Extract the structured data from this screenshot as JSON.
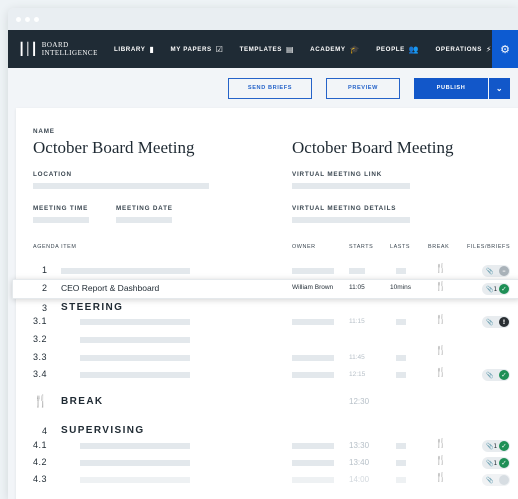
{
  "nav": {
    "logo_line1": "BOARD",
    "logo_line2": "INTELLIGENCE",
    "items": [
      {
        "label": "LIBRARY",
        "icon": "book-icon",
        "glyph": "▮"
      },
      {
        "label": "MY PAPERS",
        "icon": "checkbox-icon",
        "glyph": "☑"
      },
      {
        "label": "TEMPLATES",
        "icon": "template-icon",
        "glyph": "▤"
      },
      {
        "label": "ACADEMY",
        "icon": "graduation-cap-icon",
        "glyph": "🎓"
      },
      {
        "label": "PEOPLE",
        "icon": "people-icon",
        "glyph": "👥"
      },
      {
        "label": "OPERATIONS",
        "icon": "pulse-icon",
        "glyph": "⚡"
      }
    ],
    "gear_glyph": "⚙"
  },
  "toolbar": {
    "send_label": "SEND BRIEFS",
    "preview_label": "PREVIEW",
    "publish_label": "PUBLISH",
    "caret_glyph": "⌄"
  },
  "meeting": {
    "name_label": "NAME",
    "title": "October Board Meeting",
    "title_right": "October Board Meeting",
    "location_label": "LOCATION",
    "virtual_link_label": "VIRTUAL MEETING LINK",
    "time_label": "MEETING TIME",
    "date_label": "MEETING DATE",
    "virtual_details_label": "VIRTUAL MEETING DETAILS"
  },
  "agenda": {
    "headers": {
      "item": "AGENDA ITEM",
      "owner": "OWNER",
      "starts": "STARTS",
      "lasts": "LASTS",
      "break": "BREAK",
      "files": "FILES/BRIEFS"
    },
    "rows": {
      "r1": {
        "num": "1"
      },
      "r2": {
        "num": "2",
        "title": "CEO Report & Dashboard",
        "owner": "William Brown",
        "starts": "11:05",
        "lasts": "10mins",
        "files": "1"
      },
      "r3": {
        "num": "3",
        "title": "STEERING"
      },
      "r31": {
        "num": "3.1",
        "starts": "11:15"
      },
      "r32": {
        "num": "3.2"
      },
      "r33": {
        "num": "3.3",
        "starts": "11:45"
      },
      "r34": {
        "num": "3.4",
        "starts": "12:15"
      },
      "rbreak": {
        "title": "BREAK",
        "starts": "12:30"
      },
      "r4": {
        "num": "4",
        "title": "SUPERVISING"
      },
      "r41": {
        "num": "4.1",
        "starts": "13:30",
        "files": "1"
      },
      "r42": {
        "num": "4.2",
        "starts": "13:40",
        "files": "1"
      },
      "r43": {
        "num": "4.3",
        "starts": "14:00"
      }
    },
    "fork_glyph": "🍴",
    "clip_glyph": "📎",
    "check_glyph": "✓",
    "warn_glyph": "!",
    "minus_glyph": "–"
  }
}
